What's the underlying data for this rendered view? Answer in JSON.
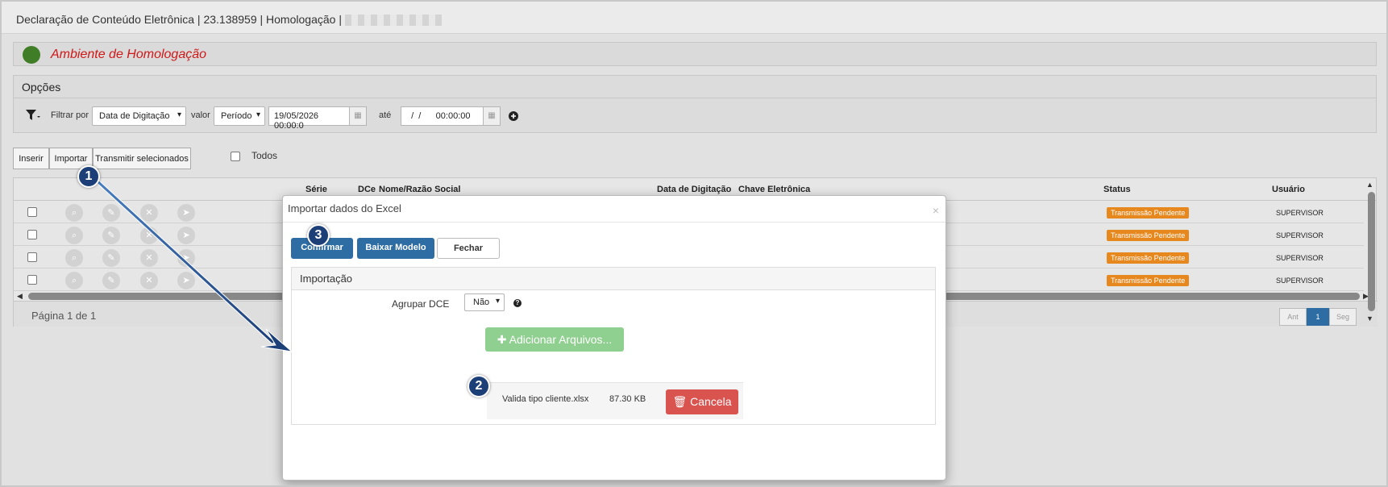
{
  "title": "Declaração de Conteúdo Eletrônica | 23.138959 | Homologação |",
  "env": {
    "label": "Ambiente de Homologação",
    "color": "#d01818",
    "dot_color": "#3f7d26"
  },
  "options": {
    "header": "Opções",
    "filter_label": "Filtrar por",
    "filter_value": "Data de Digitação",
    "valor_label": "valor",
    "valor_value": "Período",
    "date_from": "19/05/2026 00:00:0",
    "ate_label": "até",
    "date_to": "  /  /      00:00:00"
  },
  "buttons": {
    "inserir": "Inserir",
    "importar": "Importar",
    "transmitir": "Transmitir selecionados",
    "todos": "Todos"
  },
  "grid": {
    "headers": {
      "serie": "Série",
      "dce": "DCe",
      "nome": "Nome/Razão Social",
      "data": "Data de Digitação",
      "chave": "Chave Eletrônica",
      "status": "Status",
      "usuario": "Usuário"
    },
    "rows": [
      {
        "status": "Transmissão Pendente",
        "usuario": "SUPERVISOR"
      },
      {
        "status": "Transmissão Pendente",
        "usuario": "SUPERVISOR"
      },
      {
        "status": "Transmissão Pendente",
        "usuario": "SUPERVISOR"
      },
      {
        "status": "Transmissão Pendente",
        "usuario": "SUPERVISOR"
      }
    ],
    "status_color": "#e7881f"
  },
  "pagination": {
    "label": "Página 1 de 1",
    "prev": "Ant",
    "current": "1",
    "next": "Seg"
  },
  "modal": {
    "title": "Importar dados do Excel",
    "close": "×",
    "confirm": "Confirmar",
    "download": "Baixar Modelo",
    "close_btn": "Fechar",
    "panel_title": "Importação",
    "group_label": "Agrupar DCE",
    "group_value": "Não",
    "help": "?",
    "add_files": "Adicionar Arquivos...",
    "file_name": "Valida tipo cliente.xlsx",
    "file_size": "87.30 KB",
    "cancel": "Cancela"
  },
  "callouts": [
    "1",
    "2",
    "3"
  ],
  "accent": "#2e6da4",
  "callout_color": "#1d3f78"
}
